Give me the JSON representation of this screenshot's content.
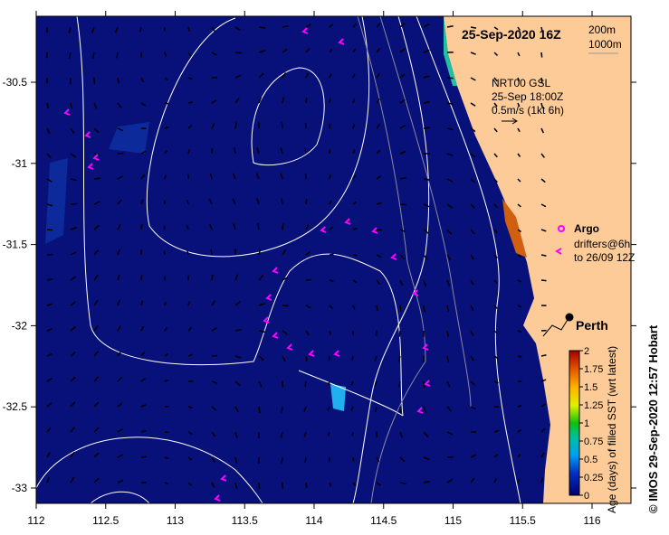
{
  "title": "25-Sep-2020 16Z",
  "depth_legend": [
    "200m",
    "1000m"
  ],
  "current_legend": {
    "source": "NRT00 GSL",
    "time": "25-Sep 18:00Z",
    "scale": "0.5m/s (1kt 6h)"
  },
  "markers_legend": {
    "argo": "Argo",
    "drifters_line1": "drifters@6h",
    "drifters_line2": "to 26/09 12Z"
  },
  "city": "Perth",
  "credit": "© IMOS 29-Sep-2020 12:57 Hobart",
  "colorbar": {
    "label": "Age (days) of filled SST (wrt latest)",
    "ticks": [
      "0",
      "0.25",
      "0.5",
      "0.75",
      "1",
      "1.25",
      "1.5",
      "1.75",
      "2"
    ],
    "range": [
      0,
      2
    ]
  },
  "x_ticks": [
    "112",
    "112.5",
    "113",
    "113.5",
    "114",
    "114.5",
    "115",
    "115.5",
    "116"
  ],
  "y_ticks": [
    "-30.5",
    "-31",
    "-31.5",
    "-32",
    "-32.5",
    "-33"
  ],
  "colors": {
    "ocean": "#08107a",
    "land": "#fdcb98",
    "drifter": "#ff00ff",
    "contour": "#ffffff"
  }
}
